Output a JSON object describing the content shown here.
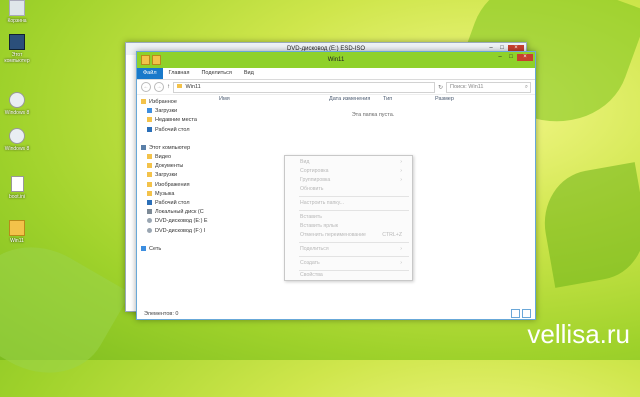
{
  "desktop": {
    "icons": [
      {
        "label": "Корзина",
        "icon": "recycle-bin-icon"
      },
      {
        "label": "Этот компьютер",
        "icon": "computer-icon"
      },
      {
        "label": "Windows 8",
        "icon": "disc-icon"
      },
      {
        "label": "Windows 8",
        "icon": "disc-icon"
      },
      {
        "label": "boot.ini",
        "icon": "file-icon"
      },
      {
        "label": "Win11",
        "icon": "folder-icon"
      }
    ],
    "watermark": "vellisa.ru"
  },
  "back_window": {
    "title": "DVD-дисковод (E:) ESD-ISO"
  },
  "window": {
    "title": "Win11",
    "ribbon_tabs": [
      "Файл",
      "Главная",
      "Поделиться",
      "Вид"
    ],
    "address": "Win11",
    "search_placeholder": "Поиск: Win11",
    "columns": [
      "Имя",
      "Дата изменения",
      "Тип",
      "Размер"
    ],
    "empty_text": "Эта папка пуста.",
    "status": "Элементов: 0"
  },
  "navpane": {
    "favorites": "Избранное",
    "fav_items": [
      "Загрузки",
      "Недавние места",
      "Рабочий стол"
    ],
    "computer": "Этот компьютер",
    "comp_items": [
      "Видео",
      "Документы",
      "Загрузки",
      "Изображения",
      "Музыка",
      "Рабочий стол",
      "Локальный диск (C",
      "DVD-дисковод (E:) E",
      "DVD-дисковод (F:) I"
    ],
    "network": "Сеть"
  },
  "context_menu": {
    "items": [
      "Вид",
      "Сортировка",
      "Группировка",
      "Обновить",
      "Настроить папку...",
      "Вставить",
      "Вставить ярлык",
      "Отменить переименование",
      "Поделиться",
      "Создать",
      "Свойства"
    ],
    "shortcut": "CTRL+Z"
  },
  "colors": {
    "titlebar": "#8fd12a",
    "accent": "#1979ca",
    "close": "#c7402e"
  }
}
